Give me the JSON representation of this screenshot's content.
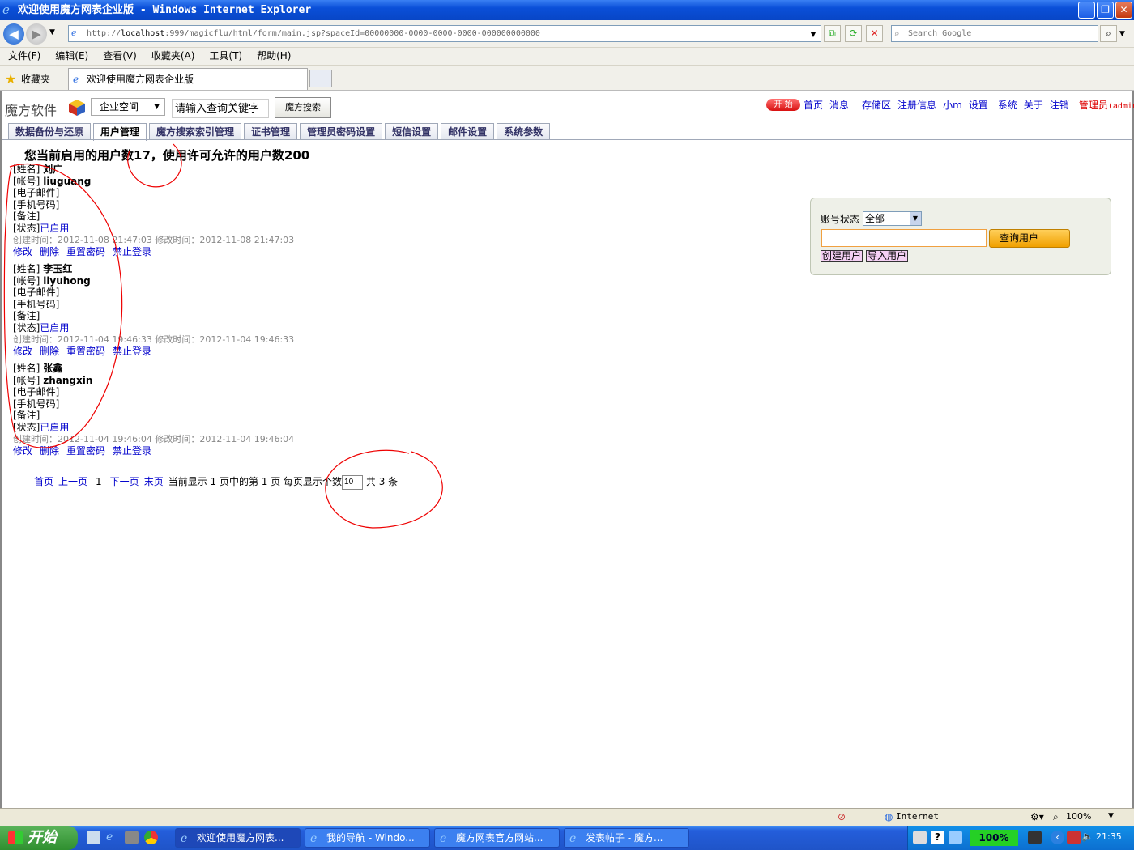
{
  "window": {
    "title": "欢迎使用魔方网表企业版 - Windows Internet Explorer"
  },
  "browser": {
    "url_prefix": "http://",
    "url_host": "localhost",
    "url_rest": ":999/magicflu/html/form/main.jsp?spaceId=00000000-0000-0000-0000-000000000000",
    "search_placeholder": "Search Google",
    "menu": [
      "文件(F)",
      "编辑(E)",
      "查看(V)",
      "收藏夹(A)",
      "工具(T)",
      "帮助(H)"
    ],
    "favorites_label": "收藏夹",
    "tab_title": "欢迎使用魔方网表企业版"
  },
  "app": {
    "logo_text": "魔方软件",
    "space_select": "企业空间",
    "search_keyword": "请输入查询关键字",
    "search_button": "魔方搜索",
    "start_badge": "开 始",
    "topnav": [
      "首页",
      "消息",
      "存储区",
      "注册信息",
      "小m",
      "设置",
      "系统",
      "关于",
      "注销"
    ],
    "admin_label": "管理员",
    "admin_user": "(admin)",
    "tabs": [
      "数据备份与还原",
      "用户管理",
      "魔方搜索索引管理",
      "证书管理",
      "管理员密码设置",
      "短信设置",
      "邮件设置",
      "系统参数"
    ],
    "active_tab": "用户管理"
  },
  "main": {
    "headline": "您当前启用的用户数17，使用许可允许的用户数200",
    "labels": {
      "name": "[姓名]",
      "account": "[帐号]",
      "email": "[电子邮件]",
      "phone": "[手机号码]",
      "note": "[备注]",
      "status": "[状态]"
    },
    "actions": {
      "edit": "修改",
      "delete": "删除",
      "reset": "重置密码",
      "ban": "禁止登录"
    },
    "users": [
      {
        "name": "刘广",
        "account": "liuguang",
        "status": "已启用",
        "meta": "创建时间：2012-11-08 21:47:03 修改时间：2012-11-08 21:47:03"
      },
      {
        "name": "李玉红",
        "account": "liyuhong",
        "status": "已启用",
        "meta": "创建时间：2012-11-04 19:46:33 修改时间：2012-11-04 19:46:33"
      },
      {
        "name": "张鑫",
        "account": "zhangxin",
        "status": "已启用",
        "meta": "创建时间：2012-11-04 19:46:04 修改时间：2012-11-04 19:46:04"
      }
    ],
    "pager": {
      "first": "首页",
      "prev": "上一页",
      "page": "1",
      "next": "下一页",
      "last": "末页",
      "info": "当前显示 1 页中的第 1 页  每页显示个数",
      "per_page": "10",
      "total": "共 3 条"
    }
  },
  "panel": {
    "status_label": "账号状态",
    "status_value": "全部",
    "query_button": "查询用户",
    "create_button": "创建用户",
    "import_button": "导入用户"
  },
  "statusbar": {
    "zone": "Internet",
    "zoom": "100%"
  },
  "taskbar": {
    "start": "开始",
    "tasks": [
      "欢迎使用魔方网表...",
      "我的导航 - Windo...",
      "魔方网表官方网站...",
      "发表帖子 - 魔方..."
    ],
    "zoom": "100%",
    "clock": "21:35"
  },
  "colors": {
    "link": "#0000cc",
    "titlebar": "#0a4fd8",
    "annotation": "#e00000"
  }
}
